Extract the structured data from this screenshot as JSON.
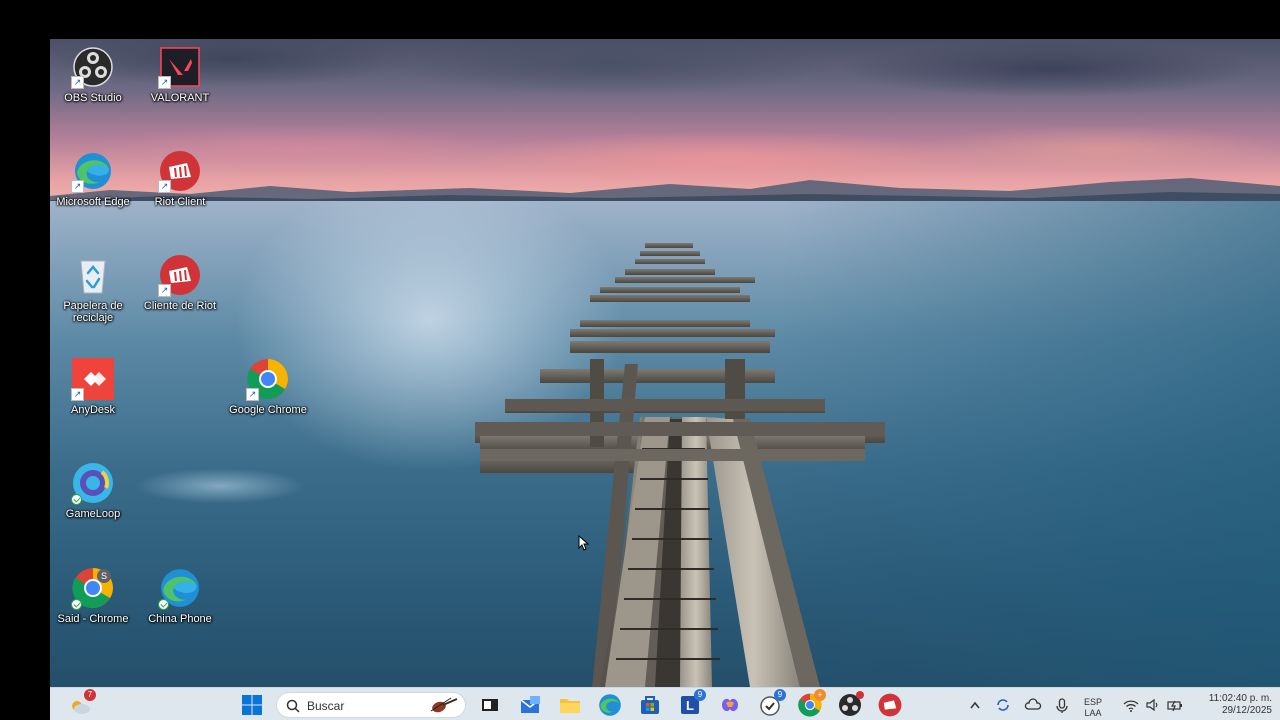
{
  "desktop": {
    "icons": [
      {
        "label": "OBS Studio",
        "icon": "obs-studio-icon"
      },
      {
        "label": "VALORANT",
        "icon": "valorant-icon"
      },
      {
        "label": "Microsoft Edge",
        "icon": "microsoft-edge-icon"
      },
      {
        "label": "Riot Client",
        "icon": "riot-client-icon"
      },
      {
        "label": "Papelera de\nreciclaje",
        "icon": "recycle-bin-icon"
      },
      {
        "label": "Cliente de Riot",
        "icon": "riot-client-icon"
      },
      {
        "label": "AnyDesk",
        "icon": "anydesk-icon"
      },
      {
        "label": "Google Chrome",
        "icon": "google-chrome-icon"
      },
      {
        "label": "GameLoop",
        "icon": "gameloop-icon"
      },
      {
        "label": "Said - Chrome",
        "icon": "chrome-profile-icon"
      },
      {
        "label": "China Phone",
        "icon": "microsoft-edge-icon"
      }
    ]
  },
  "taskbar": {
    "search_placeholder": "Buscar",
    "weather_badge": "7",
    "outlook_badge": "9",
    "copilot_badge": "9",
    "chrome_badge": "+",
    "language": "ESP",
    "language_sub": "LAA",
    "time": "11:02:40 p. m.",
    "date": "29/12/2025"
  },
  "colors": {
    "taskbar_bg": "#dfe7ee",
    "accent": "#0067c0",
    "riot_red": "#d13438"
  }
}
